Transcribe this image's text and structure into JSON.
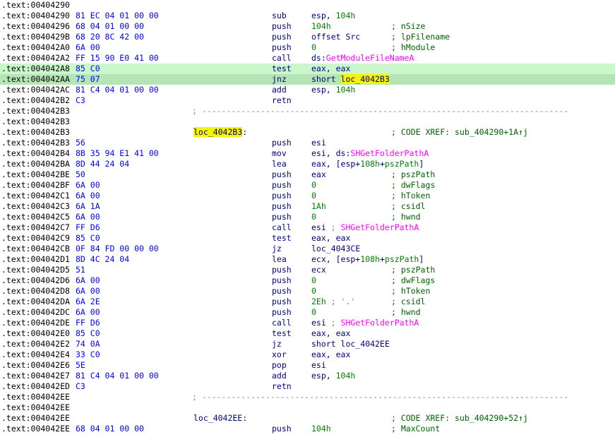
{
  "colors": {
    "background": "#ffffff",
    "address": "#000000",
    "bytes": "#0000ff",
    "mnemonic": "#000080",
    "number": "#008000",
    "import": "#ff00ff",
    "comment": "#006400",
    "highlight_current": "#b5e5b5",
    "highlight_line": "#ccf7cc",
    "highlight_label": "#f6f500"
  },
  "lines": [
    {
      "addr": ".text:00404290",
      "bytes": "",
      "mn": "",
      "ops": [],
      "cmt": ""
    },
    {
      "addr": ".text:00404290",
      "bytes": "81 EC 04 01 00 00",
      "mn": "sub",
      "ops": [
        {
          "t": "esp, "
        },
        {
          "t": "104h",
          "k": "num"
        }
      ],
      "cmt": ""
    },
    {
      "addr": ".text:00404296",
      "bytes": "68 04 01 00 00",
      "mn": "push",
      "ops": [
        {
          "t": "104h",
          "k": "num"
        }
      ],
      "cmt": "; nSize"
    },
    {
      "addr": ".text:0040429B",
      "bytes": "68 20 8C 42 00",
      "mn": "push",
      "ops": [
        {
          "t": "offset Src"
        }
      ],
      "cmt": "; lpFilename"
    },
    {
      "addr": ".text:004042A0",
      "bytes": "6A 00",
      "mn": "push",
      "ops": [
        {
          "t": "0",
          "k": "num"
        }
      ],
      "cmt": "; hModule"
    },
    {
      "addr": ".text:004042A2",
      "bytes": "FF 15 90 E0 41 00",
      "mn": "call",
      "ops": [
        {
          "t": "ds:"
        },
        {
          "t": "GetModuleFileNameA",
          "k": "imp"
        }
      ],
      "cmt": ""
    },
    {
      "addr": ".text:004042A8",
      "bytes": "85 C0",
      "mn": "test",
      "ops": [
        {
          "t": "eax, eax"
        }
      ],
      "cmt": "",
      "hl": "hl1"
    },
    {
      "addr": ".text:004042AA",
      "bytes": "75 07",
      "mn": "jnz",
      "ops": [
        {
          "t": "short "
        },
        {
          "t": "loc_4042B3",
          "k": "lblhl"
        }
      ],
      "cmt": "",
      "hl": "hl2"
    },
    {
      "addr": ".text:004042AC",
      "bytes": "81 C4 04 01 00 00",
      "mn": "add",
      "ops": [
        {
          "t": "esp, "
        },
        {
          "t": "104h",
          "k": "num"
        }
      ],
      "cmt": ""
    },
    {
      "addr": ".text:004042B2",
      "bytes": "C3",
      "mn": "retn",
      "ops": [],
      "cmt": ""
    },
    {
      "addr": ".text:004042B3",
      "bytes": "",
      "sep": "; ---------------------------------------------------------------------------"
    },
    {
      "addr": ".text:004042B3",
      "bytes": "",
      "mn": "",
      "ops": [],
      "cmt": ""
    },
    {
      "addr": ".text:004042B3",
      "bytes": "",
      "label": "loc_4042B3",
      "label_hl": true,
      "label_suffix": ":",
      "cmt": "; CODE XREF: sub_404290+1A↑j"
    },
    {
      "addr": ".text:004042B3",
      "bytes": "56",
      "mn": "push",
      "ops": [
        {
          "t": "esi"
        }
      ],
      "cmt": ""
    },
    {
      "addr": ".text:004042B4",
      "bytes": "8B 35 94 E1 41 00",
      "mn": "mov",
      "ops": [
        {
          "t": "esi, ds:"
        },
        {
          "t": "SHGetFolderPathA",
          "k": "imp"
        }
      ],
      "cmt": ""
    },
    {
      "addr": ".text:004042BA",
      "bytes": "8D 44 24 04",
      "mn": "lea",
      "ops": [
        {
          "t": "eax, [esp+"
        },
        {
          "t": "108h",
          "k": "num"
        },
        {
          "t": "+"
        },
        {
          "t": "pszPath",
          "k": "num"
        },
        {
          "t": "]"
        }
      ],
      "cmt": ""
    },
    {
      "addr": ".text:004042BE",
      "bytes": "50",
      "mn": "push",
      "ops": [
        {
          "t": "eax"
        }
      ],
      "cmt": "; pszPath"
    },
    {
      "addr": ".text:004042BF",
      "bytes": "6A 00",
      "mn": "push",
      "ops": [
        {
          "t": "0",
          "k": "num"
        }
      ],
      "cmt": "; dwFlags"
    },
    {
      "addr": ".text:004042C1",
      "bytes": "6A 00",
      "mn": "push",
      "ops": [
        {
          "t": "0",
          "k": "num"
        }
      ],
      "cmt": "; hToken"
    },
    {
      "addr": ".text:004042C3",
      "bytes": "6A 1A",
      "mn": "push",
      "ops": [
        {
          "t": "1Ah",
          "k": "num"
        }
      ],
      "cmt": "; csidl"
    },
    {
      "addr": ".text:004042C5",
      "bytes": "6A 00",
      "mn": "push",
      "ops": [
        {
          "t": "0",
          "k": "num"
        }
      ],
      "cmt": "; hwnd"
    },
    {
      "addr": ".text:004042C7",
      "bytes": "FF D6",
      "mn": "call",
      "ops": [
        {
          "t": "esi "
        },
        {
          "t": "; ",
          "k": "cmt"
        },
        {
          "t": "SHGetFolderPathA",
          "k": "imp"
        }
      ],
      "cmt": ""
    },
    {
      "addr": ".text:004042C9",
      "bytes": "85 C0",
      "mn": "test",
      "ops": [
        {
          "t": "eax, eax"
        }
      ],
      "cmt": ""
    },
    {
      "addr": ".text:004042CB",
      "bytes": "0F 84 FD 00 00 00",
      "mn": "jz",
      "ops": [
        {
          "t": "loc_4043CE"
        }
      ],
      "cmt": ""
    },
    {
      "addr": ".text:004042D1",
      "bytes": "8D 4C 24 04",
      "mn": "lea",
      "ops": [
        {
          "t": "ecx, [esp+"
        },
        {
          "t": "108h",
          "k": "num"
        },
        {
          "t": "+"
        },
        {
          "t": "pszPath",
          "k": "num"
        },
        {
          "t": "]"
        }
      ],
      "cmt": ""
    },
    {
      "addr": ".text:004042D5",
      "bytes": "51",
      "mn": "push",
      "ops": [
        {
          "t": "ecx"
        }
      ],
      "cmt": "; pszPath"
    },
    {
      "addr": ".text:004042D6",
      "bytes": "6A 00",
      "mn": "push",
      "ops": [
        {
          "t": "0",
          "k": "num"
        }
      ],
      "cmt": "; dwFlags"
    },
    {
      "addr": ".text:004042D8",
      "bytes": "6A 00",
      "mn": "push",
      "ops": [
        {
          "t": "0",
          "k": "num"
        }
      ],
      "cmt": "; hToken"
    },
    {
      "addr": ".text:004042DA",
      "bytes": "6A 2E",
      "mn": "push",
      "ops": [
        {
          "t": "2Eh",
          "k": "num"
        },
        {
          "t": " ; '.'",
          "k": "cmt"
        }
      ],
      "cmt": "; csidl"
    },
    {
      "addr": ".text:004042DC",
      "bytes": "6A 00",
      "mn": "push",
      "ops": [
        {
          "t": "0",
          "k": "num"
        }
      ],
      "cmt": "; hwnd"
    },
    {
      "addr": ".text:004042DE",
      "bytes": "FF D6",
      "mn": "call",
      "ops": [
        {
          "t": "esi "
        },
        {
          "t": "; ",
          "k": "cmt"
        },
        {
          "t": "SHGetFolderPathA",
          "k": "imp"
        }
      ],
      "cmt": ""
    },
    {
      "addr": ".text:004042E0",
      "bytes": "85 C0",
      "mn": "test",
      "ops": [
        {
          "t": "eax, eax"
        }
      ],
      "cmt": ""
    },
    {
      "addr": ".text:004042E2",
      "bytes": "74 0A",
      "mn": "jz",
      "ops": [
        {
          "t": "short loc_4042EE"
        }
      ],
      "cmt": ""
    },
    {
      "addr": ".text:004042E4",
      "bytes": "33 C0",
      "mn": "xor",
      "ops": [
        {
          "t": "eax, eax"
        }
      ],
      "cmt": ""
    },
    {
      "addr": ".text:004042E6",
      "bytes": "5E",
      "mn": "pop",
      "ops": [
        {
          "t": "esi"
        }
      ],
      "cmt": ""
    },
    {
      "addr": ".text:004042E7",
      "bytes": "81 C4 04 01 00 00",
      "mn": "add",
      "ops": [
        {
          "t": "esp, "
        },
        {
          "t": "104h",
          "k": "num"
        }
      ],
      "cmt": ""
    },
    {
      "addr": ".text:004042ED",
      "bytes": "C3",
      "mn": "retn",
      "ops": [],
      "cmt": ""
    },
    {
      "addr": ".text:004042EE",
      "bytes": "",
      "sep": "; ---------------------------------------------------------------------------"
    },
    {
      "addr": ".text:004042EE",
      "bytes": "",
      "mn": "",
      "ops": [],
      "cmt": ""
    },
    {
      "addr": ".text:004042EE",
      "bytes": "",
      "label": "loc_4042EE",
      "label_hl": false,
      "label_suffix": ":",
      "cmt": "; CODE XREF: sub_404290+52↑j"
    },
    {
      "addr": ".text:004042EE",
      "bytes": "68 04 01 00 00",
      "mn": "push",
      "ops": [
        {
          "t": "104h",
          "k": "num"
        }
      ],
      "cmt": "; MaxCount"
    }
  ]
}
